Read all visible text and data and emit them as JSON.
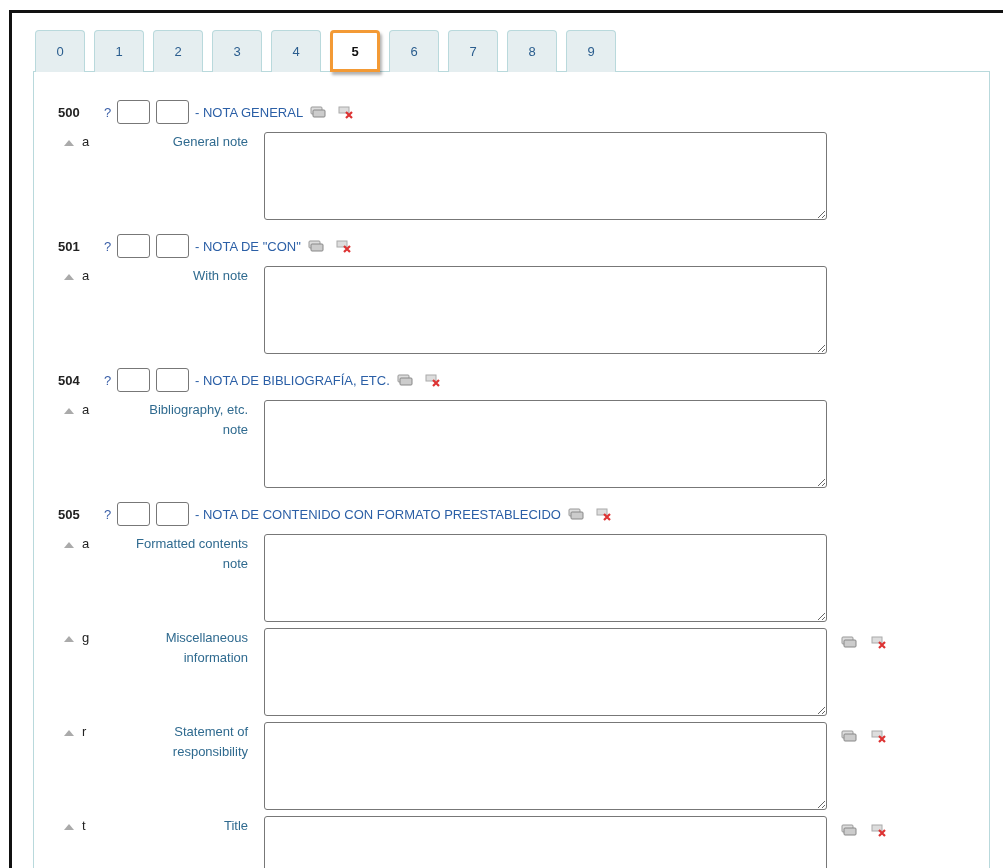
{
  "tabs": [
    {
      "label": "0",
      "selected": false
    },
    {
      "label": "1",
      "selected": false
    },
    {
      "label": "2",
      "selected": false
    },
    {
      "label": "3",
      "selected": false
    },
    {
      "label": "4",
      "selected": false
    },
    {
      "label": "5",
      "selected": true
    },
    {
      "label": "6",
      "selected": false
    },
    {
      "label": "7",
      "selected": false
    },
    {
      "label": "8",
      "selected": false
    },
    {
      "label": "9",
      "selected": false
    }
  ],
  "fields": [
    {
      "tag": "500",
      "help": "?",
      "title": "- NOTA GENERAL",
      "subfields": [
        {
          "code": "a",
          "label": "General note",
          "show_actions": false
        }
      ]
    },
    {
      "tag": "501",
      "help": "?",
      "title": "- NOTA DE \"CON\"",
      "subfields": [
        {
          "code": "a",
          "label": "With note",
          "show_actions": false
        }
      ]
    },
    {
      "tag": "504",
      "help": "?",
      "title": "- NOTA DE BIBLIOGRAFÍA, ETC.",
      "subfields": [
        {
          "code": "a",
          "label": "Bibliography, etc. note",
          "show_actions": false
        }
      ]
    },
    {
      "tag": "505",
      "help": "?",
      "title": "- NOTA DE CONTENIDO CON FORMATO PREESTABLECIDO",
      "subfields": [
        {
          "code": "a",
          "label": "Formatted contents note",
          "show_actions": false
        },
        {
          "code": "g",
          "label": "Miscellaneous information",
          "show_actions": true
        },
        {
          "code": "r",
          "label": "Statement of responsibility",
          "show_actions": true
        },
        {
          "code": "t",
          "label": "Title",
          "show_actions": true
        }
      ]
    }
  ]
}
